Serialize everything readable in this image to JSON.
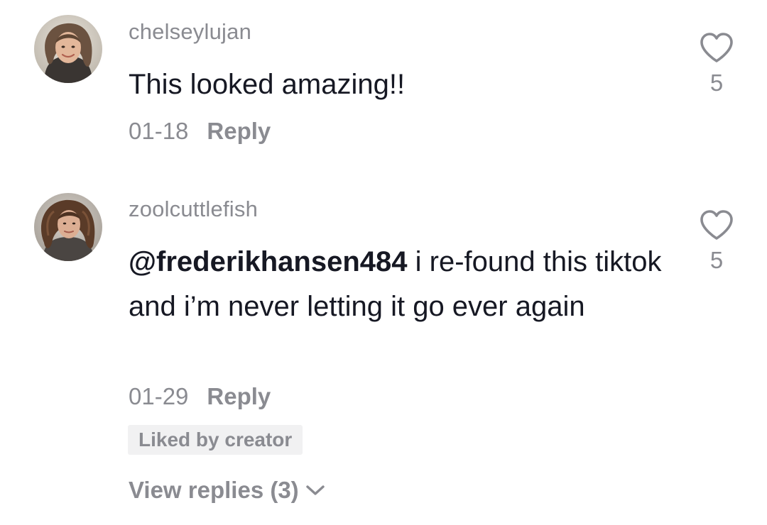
{
  "comments": [
    {
      "username": "chelseylujan",
      "text": "This looked amazing!!",
      "date": "01-18",
      "reply_label": "Reply",
      "like_count": "5",
      "avatar_icon": "user-avatar-photo"
    },
    {
      "username": "zoolcuttlefish",
      "mention": "@frederikhansen484",
      "text": " i re-found this tiktok and i’m never letting it go ever again",
      "date": "01-29",
      "reply_label": "Reply",
      "like_count": "5",
      "badge": "Liked by creator",
      "view_replies": "View replies (3)",
      "avatar_icon": "user-avatar-photo"
    }
  ],
  "icons": {
    "like": "heart-outline-icon",
    "expand": "chevron-down-icon"
  },
  "colors": {
    "primary_text": "#161823",
    "secondary_text": "#8a8b91",
    "badge_bg": "#f1f1f2"
  }
}
